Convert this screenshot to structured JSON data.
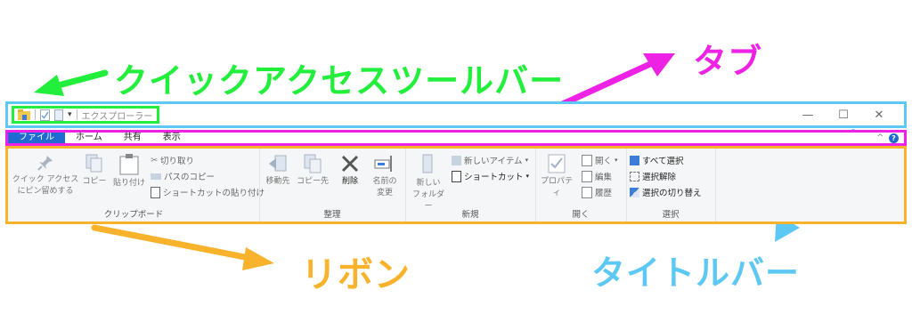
{
  "annotations": {
    "qat": "クイックアクセスツールバー",
    "tab": "タブ",
    "ribbon": "リボン",
    "titlebar": "タイトルバー"
  },
  "colors": {
    "qat": "#22ee3c",
    "tab": "#ee22e4",
    "ribbon": "#f9b22b",
    "titlebar": "#5ec8f5",
    "accent": "#1e6bd1"
  },
  "titlebar": {
    "title": "エクスプローラー",
    "controls": [
      "—",
      "☐",
      "✕"
    ]
  },
  "tabs": [
    "ファイル",
    "ホーム",
    "共有",
    "表示"
  ],
  "tabbar": {
    "collapse": "^",
    "help": "?"
  },
  "ribbon": {
    "clipboard": {
      "label": "クリップボード",
      "pin": [
        "クイック アクセス",
        "にピン留めする"
      ],
      "copy": "コピー",
      "paste": "貼り付け",
      "cut": "切り取り",
      "copy_path": "パスのコピー",
      "paste_shortcut": "ショートカットの貼り付け"
    },
    "organize": {
      "label": "整理",
      "move_to": "移動先",
      "copy_to": "コピー先",
      "delete": "削除",
      "rename": [
        "名前の",
        "変更"
      ]
    },
    "new": {
      "label": "新規",
      "new_folder": [
        "新しい",
        "フォルダー"
      ],
      "new_item": "新しいアイテム",
      "shortcut": "ショートカット"
    },
    "open": {
      "label": "開く",
      "properties": "プロパティ",
      "open": "開く",
      "edit": "編集",
      "history": "履歴"
    },
    "select": {
      "label": "選択",
      "select_all": "すべて選択",
      "select_none": "選択解除",
      "invert": "選択の切り替え"
    }
  }
}
